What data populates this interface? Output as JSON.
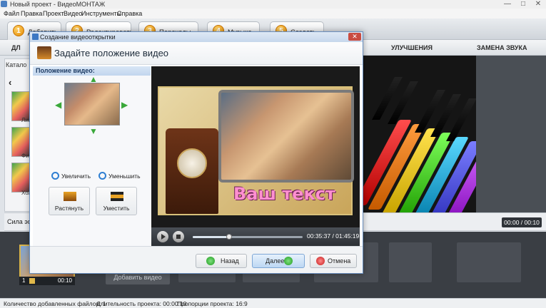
{
  "window": {
    "title": "Новый проект - ВидеоМОНТАЖ",
    "minimize": "—",
    "maximize": "□",
    "close": "✕"
  },
  "menu": [
    "Файл",
    "Правка",
    "Проект",
    "Видео",
    "Инструменты",
    "Справка"
  ],
  "steps": [
    {
      "num": "1",
      "label": "Добавить"
    },
    {
      "num": "2",
      "label": "Редактировать"
    },
    {
      "num": "3",
      "label": "Переходы"
    },
    {
      "num": "4",
      "label": "Музыка"
    },
    {
      "num": "5",
      "label": "Создать"
    }
  ],
  "subtabs": {
    "left": "ДЛ",
    "improve": "УЛУЧШЕНИЯ",
    "sound": "ЗАМЕНА ЗВУКА"
  },
  "catalog": {
    "tab": "Катало",
    "arrow": "‹",
    "thumbs": [
      "Лицо",
      "Фи",
      "Холод"
    ]
  },
  "strength": {
    "label": "Сила эфф",
    "time": "00:00 / 00:10"
  },
  "timeline": {
    "clip_num": "1",
    "clip_time": "00:10",
    "add_video": "Добавить видео"
  },
  "status": {
    "files": "Количество добавленных файлов: 1",
    "duration": "Длительность проекта: 00:00:10",
    "ratio": "Пропорции проекта: 16:9"
  },
  "dialog": {
    "title": "Создание видеооткрытки",
    "close": "✕",
    "header": "Задайте положение видео",
    "position_head": "Положение видео:",
    "zoom_in": "Увеличить",
    "zoom_out": "Уменьшить",
    "stretch": "Растянуть",
    "fit": "Уместить",
    "overlay_text": "Ваш текст",
    "player_time": "00:35:37 / 01:45:19",
    "player_progress": 0.33,
    "buttons": {
      "back": "Назад",
      "next": "Далее",
      "cancel": "Отмена"
    }
  }
}
